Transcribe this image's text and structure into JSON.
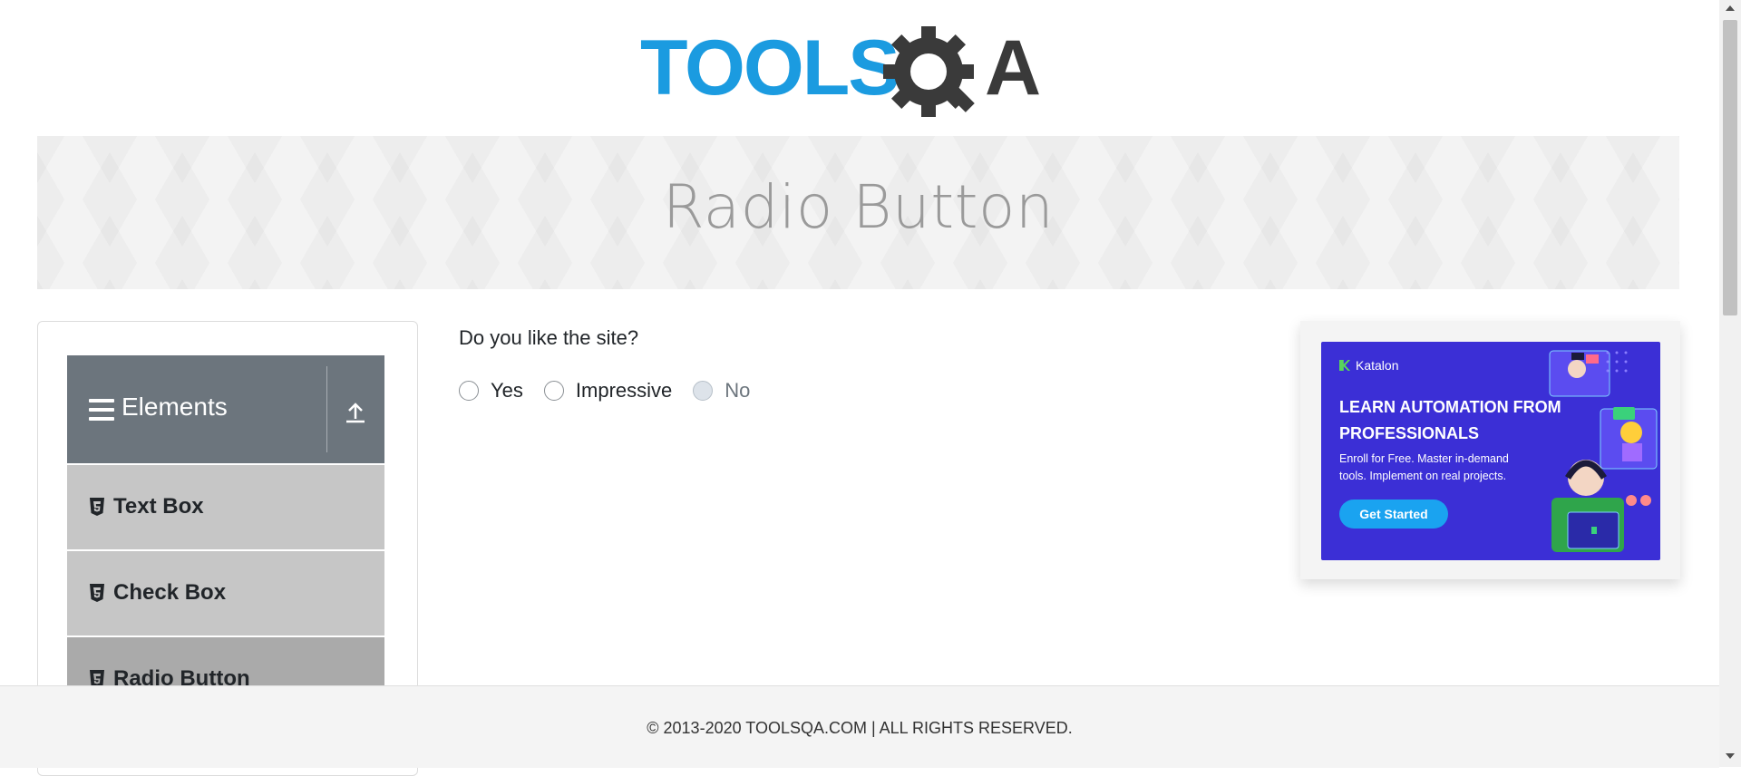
{
  "logo": {
    "text_main": "TOOLS",
    "text_end": "A",
    "gear_char": "Q",
    "color_blue": "#1b9be0",
    "color_dark": "#3a3a3a"
  },
  "banner": {
    "title": "Radio Button"
  },
  "sidebar": {
    "group_title": "Elements",
    "items": [
      {
        "label": "Text Box"
      },
      {
        "label": "Check Box"
      },
      {
        "label": "Radio Button"
      }
    ]
  },
  "form": {
    "question": "Do you like the site?",
    "options": [
      {
        "label": "Yes",
        "disabled": false
      },
      {
        "label": "Impressive",
        "disabled": false
      },
      {
        "label": "No",
        "disabled": true
      }
    ]
  },
  "ad": {
    "brand": "Katalon",
    "headline": "LEARN AUTOMATION FROM PROFESSIONALS",
    "subtext": "Enroll for Free. Master in-demand tools. Implement on real projects.",
    "cta": "Get Started"
  },
  "footer": {
    "text": "© 2013-2020 TOOLSQA.COM | ALL RIGHTS RESERVED."
  },
  "colors": {
    "accent": "#1b9be0",
    "header_gray": "#6c757d",
    "ad_bg": "#3b2fd6"
  }
}
